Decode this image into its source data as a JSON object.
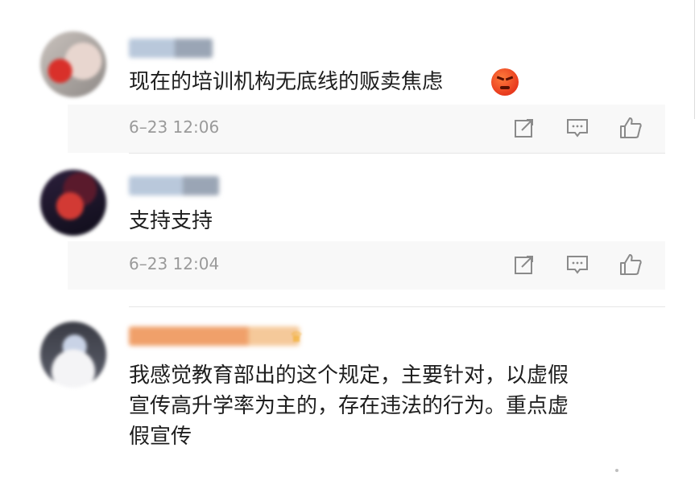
{
  "comments": [
    {
      "username": "",
      "text": "现在的培训机构无底线的贩卖焦虑",
      "emoji": "angry-face",
      "time": "6–23 12:06"
    },
    {
      "username": "",
      "text": "支持支持",
      "time": "6–23 12:04"
    },
    {
      "username": "",
      "text": "我感觉教育部出的这个规定，主要针对，以虚假\n宣传高升学率为主的，存在违法的行为。重点虚\n假宣传"
    }
  ],
  "icons": {
    "share": "share-icon",
    "reply": "reply-icon",
    "like": "like-icon"
  },
  "colors": {
    "meta_bg": "#f8f8f8",
    "time_text": "#9a9a9a",
    "icon_stroke": "#8a8a8a"
  }
}
